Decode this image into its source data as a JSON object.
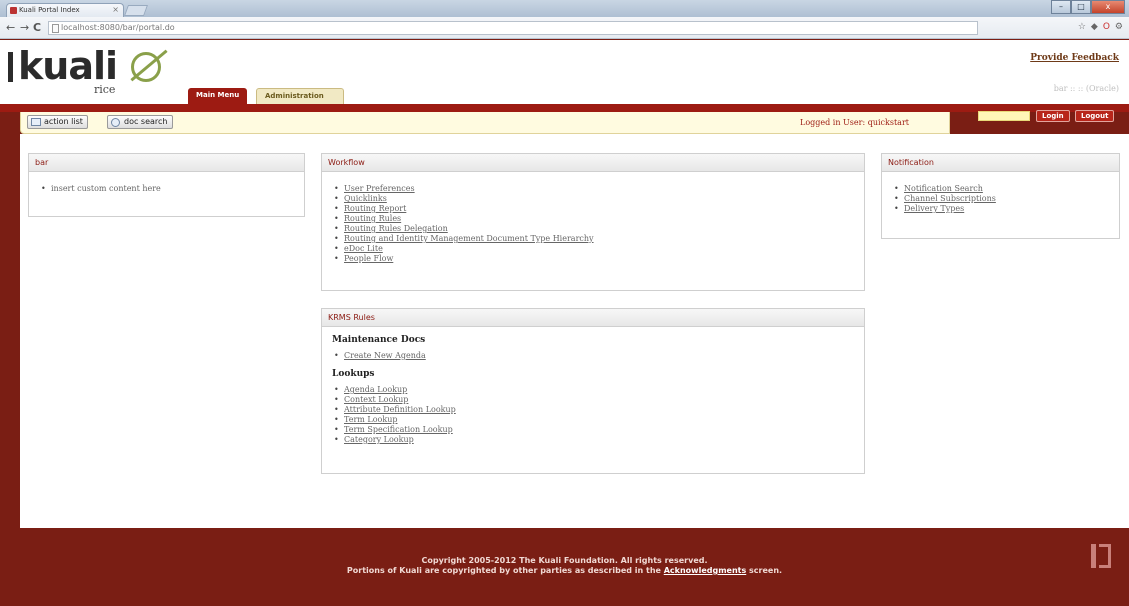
{
  "browser": {
    "tab_title": "Kuali Portal Index",
    "tab_close": "×",
    "url": "localhost:8080/bar/portal.do",
    "nav_back": "←",
    "nav_forward": "→",
    "nav_reload": "C",
    "window_minimize": "–",
    "window_restore": "□",
    "window_close": "x"
  },
  "header": {
    "logo_text": "kuali",
    "logo_subtext": "rice",
    "tabs": [
      {
        "label": "Main Menu"
      },
      {
        "label": "Administration"
      }
    ],
    "feedback_link": "Provide Feedback",
    "db_info": "bar :: :: (Oracle)"
  },
  "toolbar": {
    "action_list": "action list",
    "doc_search": "doc search",
    "logged_in": "Logged in User: quickstart"
  },
  "login": {
    "login_label": "Login",
    "logout_label": "Logout",
    "input_value": ""
  },
  "panels": {
    "bar": {
      "title": "bar",
      "items": [
        "insert custom content here"
      ]
    },
    "workflow": {
      "title": "Workflow",
      "items": [
        "User Preferences",
        "Quicklinks",
        "Routing Report",
        "Routing Rules",
        "Routing Rules Delegation",
        "Routing and Identity Management Document Type Hierarchy",
        "eDoc Lite",
        "People Flow"
      ]
    },
    "notification": {
      "title": "Notification",
      "items": [
        "Notification Search",
        "Channel Subscriptions",
        "Delivery Types"
      ]
    },
    "krms": {
      "title": "KRMS Rules",
      "section1_title": "Maintenance Docs",
      "section1_items": [
        "Create New Agenda"
      ],
      "section2_title": "Lookups",
      "section2_items": [
        "Agenda Lookup",
        "Context Lookup",
        "Attribute Definition Lookup",
        "Term Lookup",
        "Term Specification Lookup",
        "Category Lookup"
      ]
    }
  },
  "footer": {
    "line1": "Copyright 2005-2012 The Kuali Foundation. All rights reserved.",
    "line2_prefix": "Portions of Kuali are copyrighted by other parties as described in the",
    "line2_link": "Acknowledgments",
    "line2_suffix": "screen."
  },
  "colors": {
    "brand_red": "#9d1b12",
    "footer_red": "#7a1e14",
    "logo_green": "#8aa04a",
    "toolbar_yellow": "#fffbe0"
  }
}
